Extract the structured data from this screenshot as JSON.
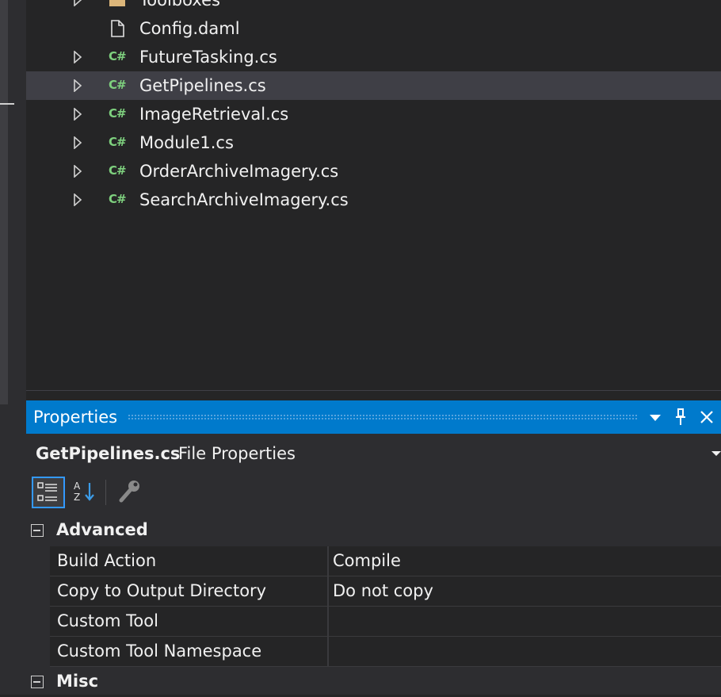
{
  "explorer": {
    "items": [
      {
        "label": "Toolboxes",
        "kind": "folder",
        "expandable": true
      },
      {
        "label": "Config.daml",
        "kind": "file",
        "expandable": false
      },
      {
        "label": "FutureTasking.cs",
        "kind": "csharp",
        "expandable": true
      },
      {
        "label": "GetPipelines.cs",
        "kind": "csharp",
        "expandable": true,
        "selected": true
      },
      {
        "label": "ImageRetrieval.cs",
        "kind": "csharp",
        "expandable": true
      },
      {
        "label": "Module1.cs",
        "kind": "csharp",
        "expandable": true
      },
      {
        "label": "OrderArchiveImagery.cs",
        "kind": "csharp",
        "expandable": true
      },
      {
        "label": "SearchArchiveImagery.cs",
        "kind": "csharp",
        "expandable": true
      }
    ],
    "csharp_icon_text": "C#"
  },
  "properties": {
    "title": "Properties",
    "subject_name": "GetPipelines.cs",
    "subject_kind": "File Properties",
    "categories": [
      {
        "name": "Advanced",
        "rows": [
          {
            "name": "Build Action",
            "value": "Compile"
          },
          {
            "name": "Copy to Output Directory",
            "value": "Do not copy"
          },
          {
            "name": "Custom Tool",
            "value": ""
          },
          {
            "name": "Custom Tool Namespace",
            "value": ""
          }
        ]
      },
      {
        "name": "Misc",
        "rows": []
      }
    ]
  },
  "colors": {
    "title_bar": "#007acc",
    "background": "#252526",
    "selected_row": "#3f3f46",
    "csharp_icon": "#7ed07e",
    "folder_icon": "#dcb67a"
  }
}
